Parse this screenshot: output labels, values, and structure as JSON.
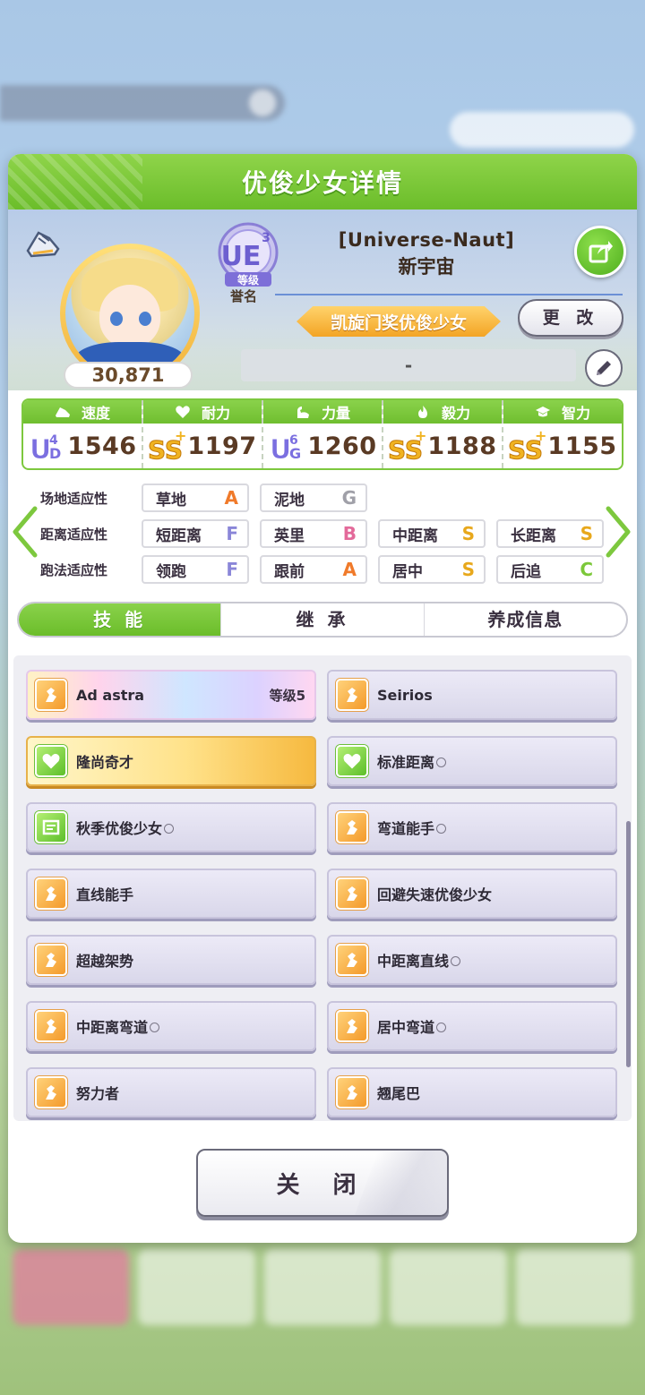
{
  "dialog": {
    "title": "优俊少女详情"
  },
  "profile": {
    "fans": "30,871",
    "rank_badge": {
      "main": "UE",
      "sup": "3",
      "sub": "等级"
    },
    "rank_label": "誉名",
    "trainer_tag": "[Universe-Naut]",
    "horse_name": "新宇宙",
    "title": "凯旋门奖优俊少女",
    "change_button": "更 改",
    "comment": "-"
  },
  "stats": [
    {
      "label": "速度",
      "icon": "shoe-icon",
      "grade": "UD",
      "grade_num": "4",
      "value": "1546"
    },
    {
      "label": "耐力",
      "icon": "heart-icon",
      "grade": "SS+",
      "grade_num": "",
      "value": "1197"
    },
    {
      "label": "力量",
      "icon": "muscle-icon",
      "grade": "UG",
      "grade_num": "6",
      "value": "1260"
    },
    {
      "label": "毅力",
      "icon": "flame-icon",
      "grade": "SS+",
      "grade_num": "",
      "value": "1188"
    },
    {
      "label": "智力",
      "icon": "graduation-cap-icon",
      "grade": "SS+",
      "grade_num": "",
      "value": "1155"
    }
  ],
  "aptitude": {
    "track": {
      "label": "场地适应性",
      "items": [
        {
          "name": "草地",
          "grade": "A"
        },
        {
          "name": "泥地",
          "grade": "G"
        }
      ]
    },
    "distance": {
      "label": "距离适应性",
      "items": [
        {
          "name": "短距离",
          "grade": "F"
        },
        {
          "name": "英里",
          "grade": "B"
        },
        {
          "name": "中距离",
          "grade": "S"
        },
        {
          "name": "长距离",
          "grade": "S"
        }
      ]
    },
    "style": {
      "label": "跑法适应性",
      "items": [
        {
          "name": "领跑",
          "grade": "F"
        },
        {
          "name": "跟前",
          "grade": "A"
        },
        {
          "name": "居中",
          "grade": "S"
        },
        {
          "name": "后追",
          "grade": "C"
        }
      ]
    }
  },
  "tabs": [
    {
      "label": "技 能",
      "active": true
    },
    {
      "label": "继 承",
      "active": false
    },
    {
      "label": "养成信息",
      "active": false
    }
  ],
  "skills": [
    {
      "name": "Ad astra",
      "level": "等级5",
      "style": "rainbow",
      "icon": "orange",
      "circle": false
    },
    {
      "name": "Seirios",
      "level": "",
      "style": "normal",
      "icon": "orange",
      "circle": false
    },
    {
      "name": "隆尚奇才",
      "level": "",
      "style": "gold",
      "icon": "green",
      "circle": false
    },
    {
      "name": "标准距离",
      "level": "",
      "style": "normal",
      "icon": "green",
      "circle": true
    },
    {
      "name": "秋季优俊少女",
      "level": "",
      "style": "normal",
      "icon": "green",
      "circle": true
    },
    {
      "name": "弯道能手",
      "level": "",
      "style": "normal",
      "icon": "orange",
      "circle": true
    },
    {
      "name": "直线能手",
      "level": "",
      "style": "normal",
      "icon": "orange",
      "circle": false
    },
    {
      "name": "回避失速优俊少女",
      "level": "",
      "style": "normal",
      "icon": "orange",
      "circle": false
    },
    {
      "name": "超越架势",
      "level": "",
      "style": "normal",
      "icon": "orange",
      "circle": false
    },
    {
      "name": "中距离直线",
      "level": "",
      "style": "normal",
      "icon": "orange",
      "circle": true
    },
    {
      "name": "中距离弯道",
      "level": "",
      "style": "normal",
      "icon": "orange",
      "circle": true
    },
    {
      "name": "居中弯道",
      "level": "",
      "style": "normal",
      "icon": "orange",
      "circle": true
    },
    {
      "name": "努力者",
      "level": "",
      "style": "normal",
      "icon": "orange",
      "circle": false
    },
    {
      "name": "翘尾巴",
      "level": "",
      "style": "normal",
      "icon": "orange",
      "circle": false
    }
  ],
  "close_button": "关 闭",
  "colors": {
    "accent_green": "#6bbd2a",
    "title_orange": "#f3a425",
    "fans_text": "#6a4a2a"
  }
}
